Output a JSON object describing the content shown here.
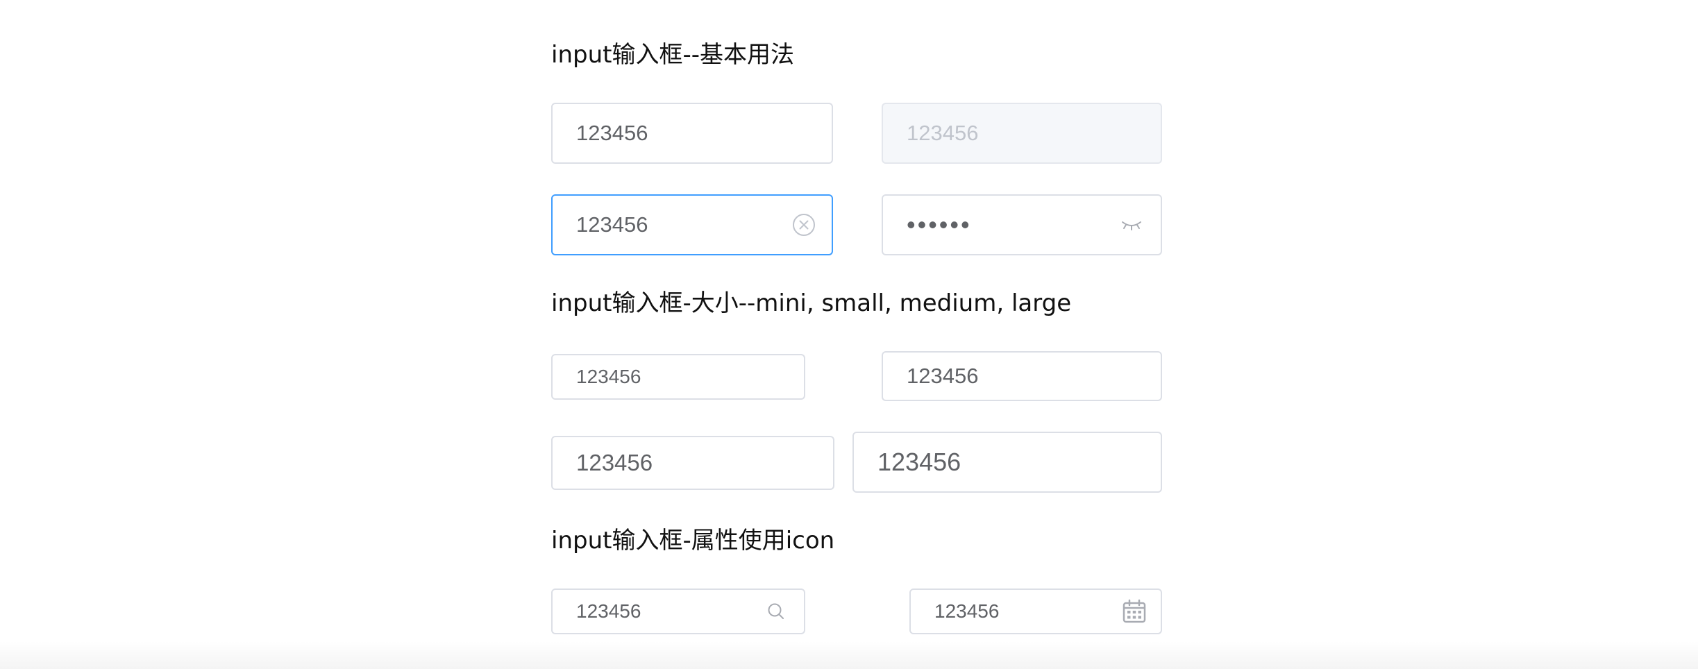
{
  "sections": [
    {
      "title": "input输入框--基本用法"
    },
    {
      "title": "input输入框-大小--mini, small, medium, large"
    },
    {
      "title": "input输入框-属性使用icon"
    }
  ],
  "basic": {
    "normal_value": "123456",
    "disabled_value": "123456",
    "clearable_value": "123456",
    "password_value": "••••••"
  },
  "sizes": {
    "mini_value": "123456",
    "small_value": "123456",
    "medium_value": "123456",
    "large_value": "123456"
  },
  "icons": {
    "search_value": "123456",
    "date_value": "123456"
  },
  "colors": {
    "border": "#dcdfe6",
    "focus_border": "#409eff",
    "disabled_bg": "#f5f7fa",
    "text": "#606266",
    "placeholder_text": "#c0c4cc"
  },
  "icon_names": {
    "clear": "circle-close-icon",
    "password": "eye-closed-icon",
    "search": "search-icon",
    "date": "calendar-icon"
  }
}
